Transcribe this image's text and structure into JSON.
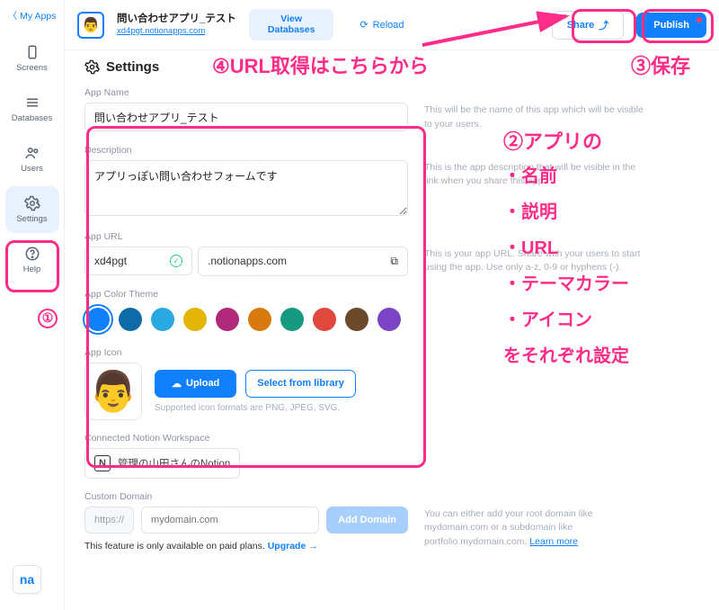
{
  "sidebar": {
    "back": "My Apps",
    "items": [
      {
        "label": "Screens"
      },
      {
        "label": "Databases"
      },
      {
        "label": "Users"
      },
      {
        "label": "Settings"
      },
      {
        "label": "Help"
      }
    ],
    "brand": "na"
  },
  "topbar": {
    "app_title": "問い合わせアプリ_テスト",
    "app_url": "xd4pgt.notionapps.com",
    "view_db_1": "View",
    "view_db_2": "Databases",
    "reload": "Reload",
    "share": "Share",
    "publish": "Publish"
  },
  "page": {
    "title": "Settings",
    "app_name_label": "App Name",
    "app_name_value": "問い合わせアプリ_テスト",
    "app_name_hint": "This will be the name of this app which will be visible to your users.",
    "desc_label": "Description",
    "desc_value": "アプリっぽい問い合わせフォームです",
    "desc_hint": "This is the app description that will be visible in the link when you share this app.",
    "url_label": "App URL",
    "url_sub": "xd4pgt",
    "url_domain": ".notionapps.com",
    "url_hint": "This is your app URL. Share with your users to start using the app. Use only a-z, 0-9 or hyphens (-).",
    "theme_label": "App Color Theme",
    "theme_swatches": [
      "#1180ff",
      "#0e6ba8",
      "#2aa9e0",
      "#e3b505",
      "#b0287a",
      "#d87a0f",
      "#159a80",
      "#e0483e",
      "#6b4a2b",
      "#7a44c4"
    ],
    "icon_label": "App Icon",
    "upload": "Upload",
    "select_lib": "Select from library",
    "icon_hint": "Supported icon formats are PNG, JPEG, SVG.",
    "workspace_label": "Connected Notion Workspace",
    "workspace_value": "管理の山田さんのNotion",
    "domain_label": "Custom Domain",
    "proto": "https://",
    "domain_placeholder": "mydomain.com",
    "add_domain": "Add Domain",
    "domain_hint_1": "You can either add your root domain like mydomain.com or a subdomain like portfolio.mydomain.com. ",
    "learn_more": "Learn more",
    "upgrade_text": "This feature is only available on paid plans. ",
    "upgrade_link": "Upgrade →"
  },
  "annotations": {
    "a1_num": "①",
    "a2_head": "②アプリの",
    "a2_lines": [
      "・名前",
      "・説明",
      "・URL",
      "・テーマカラー",
      "・アイコン",
      "をそれぞれ設定"
    ],
    "a3": "③保存",
    "a4": "④URL取得はこちらから"
  }
}
